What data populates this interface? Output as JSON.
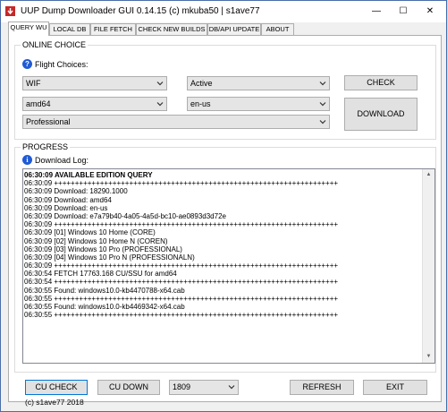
{
  "window": {
    "title": "UUP Dump Downloader GUI 0.14.15 (c) mkuba50 | s1ave77",
    "minimize_glyph": "—",
    "maximize_glyph": "☐",
    "close_glyph": "✕"
  },
  "tabs": [
    {
      "label": "QUERY WU",
      "active": true
    },
    {
      "label": "LOCAL DB",
      "active": false
    },
    {
      "label": "FILE FETCH",
      "active": false
    },
    {
      "label": "CHECK NEW BUILDS",
      "active": false
    },
    {
      "label": "DB/API UPDATE",
      "active": false
    },
    {
      "label": "ABOUT",
      "active": false
    }
  ],
  "online_choice": {
    "group_title": "ONLINE CHOICE",
    "help_glyph": "?",
    "flight_label": "Flight Choices:",
    "ring": "WIF",
    "flight": "Active",
    "arch": "amd64",
    "lang": "en-us",
    "edition": "Professional",
    "check_label": "CHECK",
    "download_label": "DOWNLOAD"
  },
  "progress": {
    "group_title": "PROGRESS",
    "info_glyph": "i",
    "log_label": "Download Log:",
    "log_lines": [
      {
        "text": "06:30:09 AVAILABLE EDITION QUERY",
        "bold": true
      },
      {
        "text": "06:30:09 ++++++++++++++++++++++++++++++++++++++++++++++++++++++++++++++++++++",
        "bold": false
      },
      {
        "text": "06:30:09 Download: 18290.1000",
        "bold": false
      },
      {
        "text": "06:30:09 Download: amd64",
        "bold": false
      },
      {
        "text": "06:30:09 Download: en-us",
        "bold": false
      },
      {
        "text": "06:30:09 Download: e7a79b40-4a05-4a5d-bc10-ae0893d3d72e",
        "bold": false
      },
      {
        "text": "06:30:09 ++++++++++++++++++++++++++++++++++++++++++++++++++++++++++++++++++++",
        "bold": false
      },
      {
        "text": "06:30:09 [01] Windows 10 Home (CORE)",
        "bold": false
      },
      {
        "text": "06:30:09 [02] Windows 10 Home N (COREN)",
        "bold": false
      },
      {
        "text": "06:30:09 [03] Windows 10 Pro (PROFESSIONAL)",
        "bold": false
      },
      {
        "text": "06:30:09 [04] Windows 10 Pro N (PROFESSIONALN)",
        "bold": false
      },
      {
        "text": "06:30:09 ++++++++++++++++++++++++++++++++++++++++++++++++++++++++++++++++++++",
        "bold": false
      },
      {
        "text": "06:30:54 FETCH  17763.168  CU/SSU for  amd64",
        "bold": false
      },
      {
        "text": "06:30:54 ++++++++++++++++++++++++++++++++++++++++++++++++++++++++++++++++++++",
        "bold": false
      },
      {
        "text": "06:30:55 Found: windows10.0-kb4470788-x64.cab",
        "bold": false
      },
      {
        "text": "06:30:55 ++++++++++++++++++++++++++++++++++++++++++++++++++++++++++++++++++++",
        "bold": false
      },
      {
        "text": "06:30:55 Found: windows10.0-kb4469342-x64.cab",
        "bold": false
      },
      {
        "text": "06:30:55 ++++++++++++++++++++++++++++++++++++++++++++++++++++++++++++++++++++",
        "bold": false
      }
    ]
  },
  "bottom": {
    "cu_check_label": "CU CHECK",
    "cu_down_label": "CU DOWN",
    "version": "1809",
    "refresh_label": "REFRESH",
    "exit_label": "EXIT",
    "copyright": "(c) s1ave77 2018"
  },
  "colors": {
    "accent": "#0078d7",
    "info_blue": "#1f5bd6",
    "window_border": "#4a6ea9"
  },
  "icons": [
    "app-icon",
    "help-icon",
    "info-icon",
    "dropdown-arrow-icon"
  ]
}
